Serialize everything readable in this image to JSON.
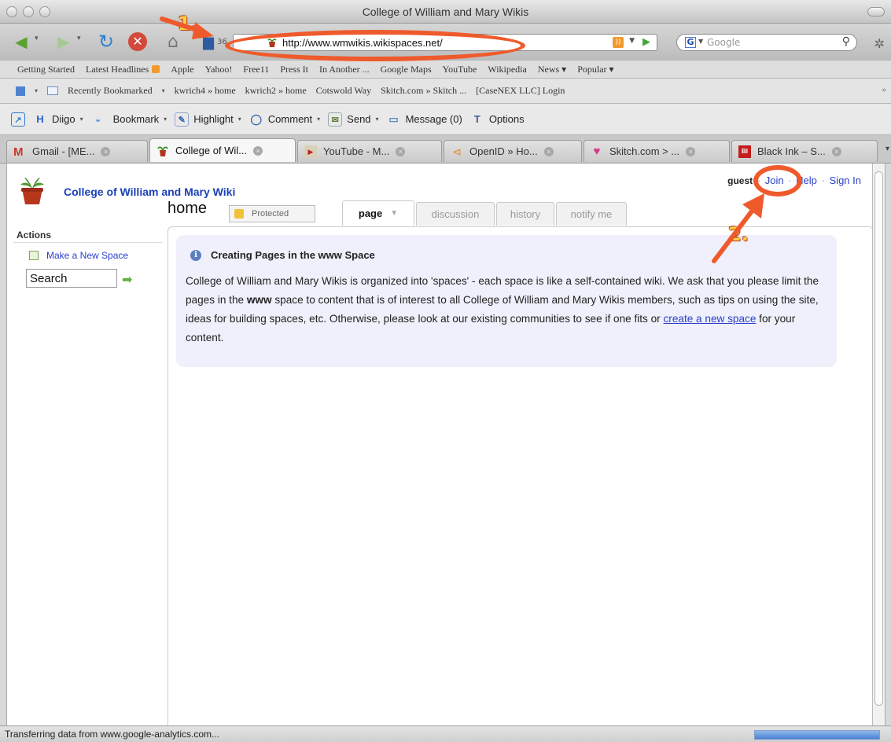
{
  "window": {
    "title": "College of William and Mary Wikis"
  },
  "nav": {
    "url": "http://www.wmwikis.wikispaces.net/",
    "search_placeholder": "Google",
    "ssl_badge": "36"
  },
  "annotations": {
    "step1": "1.",
    "step2": "2.",
    "color": "#ef5a2c"
  },
  "bookmarks": [
    "Getting Started",
    "Latest Headlines",
    "Apple",
    "Yahoo!",
    "Free11",
    "Press It",
    "In Another ...",
    "Google Maps",
    "YouTube",
    "Wikipedia",
    "News ▾",
    "Popular ▾"
  ],
  "bar2": [
    "Recently Bookmarked",
    "kwrich4 » home",
    "kwrich2 » home",
    "Cotswold Way",
    "Skitch.com » Skitch ...",
    "[CaseNEX LLC] Login"
  ],
  "diigo": {
    "diigo": "Diigo",
    "bookmark": "Bookmark",
    "highlight": "Highlight",
    "comment": "Comment",
    "send": "Send",
    "message": "Message (0)",
    "options": "Options"
  },
  "tabs": [
    "Gmail - [ME...",
    "College of Wil...",
    "YouTube - M...",
    "OpenID » Ho...",
    "Skitch.com > ...",
    "Black Ink – S..."
  ],
  "wiki": {
    "site_title": "College of William and Mary Wiki",
    "user": {
      "guest": "guest",
      "join": "Join",
      "help": "Help",
      "signin": "Sign In"
    },
    "page_name": "home",
    "protected_label": "Protected",
    "page_tabs": {
      "page": "page",
      "discussion": "discussion",
      "history": "history",
      "notify": "notify me"
    },
    "actions_title": "Actions",
    "new_space": "Make a New Space",
    "search_value": "Search",
    "notice": {
      "title": "Creating Pages in the www Space",
      "body_1": "College of William and Mary Wikis is organized into 'spaces' - each space is like a self-contained wiki. We ask that you please limit the pages in the ",
      "body_bold": "www",
      "body_2": " space to content that is of interest to all College of William and Mary Wikis members, such as tips on using the site, ideas for building spaces, etc. Otherwise, please look at our existing communities to see if one fits or ",
      "body_link": "create a new space",
      "body_3": " for your content."
    }
  },
  "status": {
    "text": "Transferring data from www.google-analytics.com...",
    "progress": 1.0
  }
}
